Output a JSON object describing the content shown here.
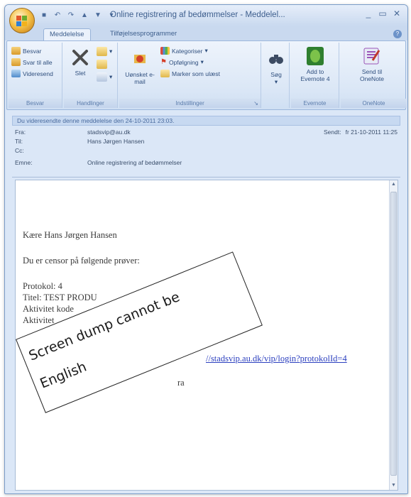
{
  "window": {
    "title": "Online registrering af bedømmelser - Meddelel...",
    "controls": {
      "minimize": "_",
      "maximize": "▭",
      "close": "✕"
    }
  },
  "ribbon_tabs": [
    {
      "label": "Meddelelse",
      "active": true
    },
    {
      "label": "Tilføjelsesprogrammer",
      "active": false
    }
  ],
  "ribbon": {
    "respond": {
      "label": "Besvar",
      "items": [
        "Besvar",
        "Svar til alle",
        "Videresend"
      ]
    },
    "actions": {
      "label": "Handlinger",
      "delete": "Slet"
    },
    "options": {
      "label": "Indstillinger",
      "junk": "Uønsket e-mail",
      "categorize": "Kategoriser",
      "followup": "Opfølgning",
      "mark_unread": "Marker som ulæst"
    },
    "find": {
      "label": "Søg"
    },
    "evernote": {
      "label": "Evernote",
      "button": "Add to Evernote 4"
    },
    "onenote": {
      "label": "OneNote",
      "button": "Send til OneNote"
    }
  },
  "infobar": "Du videresendte denne meddelelse den 24-10-2011 23:03.",
  "header": {
    "from_label": "Fra:",
    "from": "stadsvip@au.dk",
    "to_label": "Til:",
    "to": "Hans Jørgen Hansen",
    "cc_label": "Cc:",
    "cc": "",
    "subject_label": "Emne:",
    "subject": "Online registrering af bedømmelser",
    "sent_label": "Sendt:",
    "sent": "fr 21-10-2011 11:25"
  },
  "body": {
    "greeting": "Kære Hans Jørgen Hansen",
    "intro": "Du er censor på følgende prøver:",
    "protocol": "Protokol: 4",
    "title": "Titel: TEST PRODU",
    "activity_code": "Aktivitet kode",
    "activity_name": "Aktivitet",
    "link": "//stadsvip.au.dk/vip/login?protokolId=4",
    "closing": "ra"
  },
  "overlay_note": {
    "line1": "Screen dump cannot be",
    "line2": "English"
  }
}
